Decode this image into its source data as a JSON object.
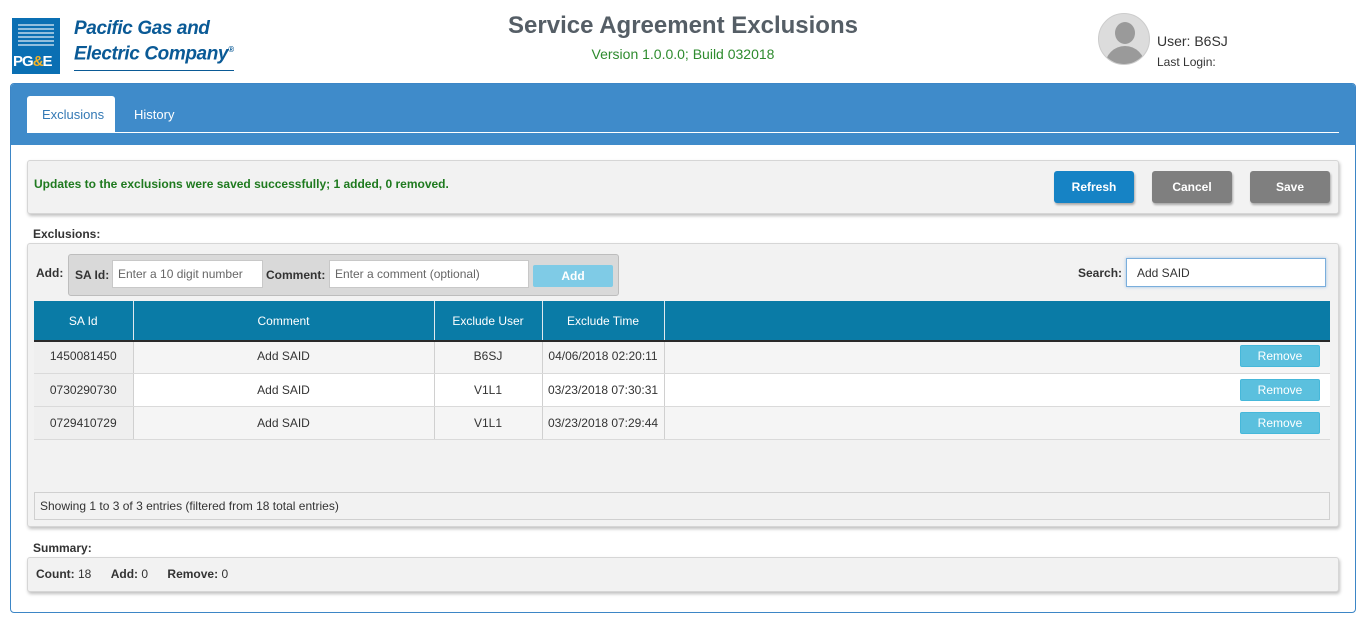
{
  "brand": {
    "logo_mark": "PG&E",
    "company_line1": "Pacific Gas and",
    "company_line2": "Electric Company",
    "registered": "®"
  },
  "header": {
    "title": "Service Agreement Exclusions",
    "version": "Version 1.0.0.0; Build 032018"
  },
  "user": {
    "user_label": "User: B6SJ",
    "last_login_label": "Last Login:"
  },
  "tabs": [
    {
      "label": "Exclusions",
      "active": true
    },
    {
      "label": "History",
      "active": false
    }
  ],
  "message": "Updates to the exclusions were saved successfully; 1 added, 0 removed.",
  "toolbar": {
    "refresh_label": "Refresh",
    "cancel_label": "Cancel",
    "save_label": "Save"
  },
  "exclusions": {
    "section_label": "Exclusions:",
    "add_label": "Add:",
    "said_label": "SA Id:",
    "said_placeholder": "Enter a 10 digit number",
    "comment_label": "Comment:",
    "comment_placeholder": "Enter a comment (optional)",
    "add_button": "Add",
    "search_label": "Search:",
    "search_value": "Add SAID",
    "columns": [
      "SA Id",
      "Comment",
      "Exclude User",
      "Exclude Time",
      ""
    ],
    "rows": [
      {
        "sa_id": "1450081450",
        "comment": "Add SAID",
        "user": "B6SJ",
        "time": "04/06/2018 02:20:11",
        "action": "Remove"
      },
      {
        "sa_id": "0730290730",
        "comment": "Add SAID",
        "user": "V1L1",
        "time": "03/23/2018 07:30:31",
        "action": "Remove"
      },
      {
        "sa_id": "0729410729",
        "comment": "Add SAID",
        "user": "V1L1",
        "time": "03/23/2018 07:29:44",
        "action": "Remove"
      }
    ],
    "footer": "Showing 1 to 3 of 3 entries (filtered from 18 total entries)"
  },
  "summary": {
    "section_label": "Summary:",
    "count_label": "Count:",
    "count_value": "18",
    "add_label": "Add:",
    "add_value": "0",
    "remove_label": "Remove:",
    "remove_value": "0"
  },
  "colors": {
    "tab_bar": "#3f8bca",
    "table_header": "#0a7ba6",
    "refresh_button": "#1683c5",
    "gray_button": "#7f7f7f",
    "remove_button": "#5bc0de",
    "success_text": "#1f7a1f"
  }
}
